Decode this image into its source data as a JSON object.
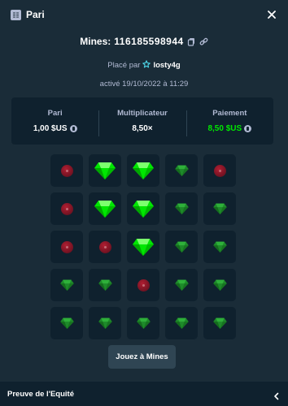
{
  "header": {
    "title": "Pari",
    "icon": "receipt-icon"
  },
  "game": {
    "label": "Mines:",
    "bet_id": "116185598944"
  },
  "placed": {
    "prefix": "Placé par",
    "user": "losty4g"
  },
  "date": "activé 19/10/2022 à 11:29",
  "stats": {
    "bet_label": "Pari",
    "bet_value": "1,00 $US",
    "multiplier_label": "Multiplicateur",
    "multiplier_value": "8,50×",
    "payout_label": "Paiement",
    "payout_value": "8,50 $US"
  },
  "grid": [
    [
      "mine",
      "gem-bright",
      "gem-bright",
      "gem",
      "mine"
    ],
    [
      "mine",
      "gem-bright",
      "gem-bright",
      "gem",
      "gem"
    ],
    [
      "mine",
      "mine",
      "gem-bright",
      "gem",
      "gem"
    ],
    [
      "gem",
      "gem",
      "mine",
      "gem",
      "gem"
    ],
    [
      "gem",
      "gem",
      "gem",
      "gem",
      "gem"
    ]
  ],
  "play_button": "Jouez à Mines",
  "footer": {
    "label": "Preuve de l'Equité"
  },
  "colors": {
    "background": "#1a2c38",
    "panel": "#0f212e",
    "accent_green": "#00e701",
    "gem_bright": "#00e701",
    "gem_dim": "#1e8a2a",
    "mine": "#8b1a2b"
  }
}
